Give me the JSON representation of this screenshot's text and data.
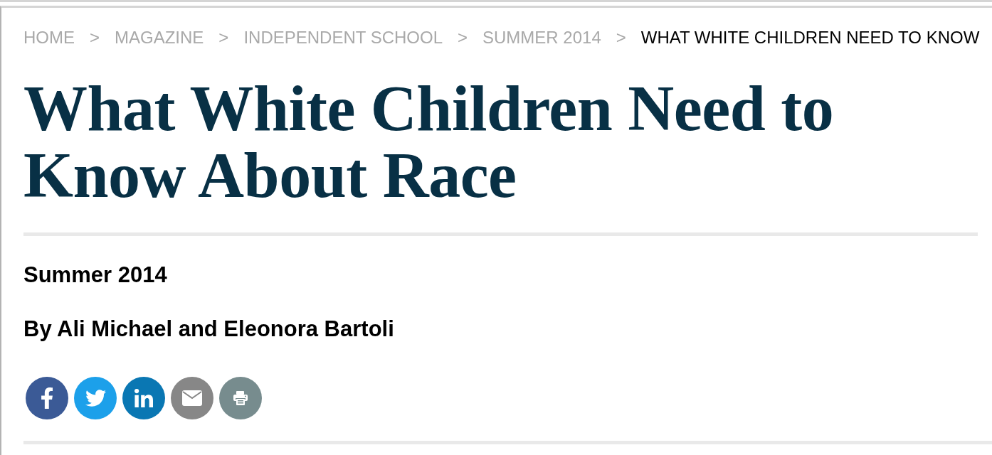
{
  "breadcrumb": [
    {
      "label": "HOME",
      "current": false,
      "separator": ">"
    },
    {
      "label": "MAGAZINE",
      "current": false,
      "separator": ">"
    },
    {
      "label": "INDEPENDENT SCHOOL",
      "current": false,
      "separator": ">"
    },
    {
      "label": "SUMMER 2014",
      "current": false,
      "separator": ">"
    },
    {
      "label": "WHAT WHITE CHILDREN NEED TO KNOW",
      "current": true
    }
  ],
  "article": {
    "title": "What White Children Need to Know About Race",
    "issue": "Summer 2014",
    "byline": "By Ali Michael and Eleonora Bartoli"
  },
  "share_buttons": [
    {
      "kind": "facebook",
      "color": "#3b5a96"
    },
    {
      "kind": "twitter",
      "color": "#1ca0ea"
    },
    {
      "kind": "linkedin",
      "color": "#0a77b3"
    },
    {
      "kind": "email",
      "color": "#878787"
    },
    {
      "kind": "print",
      "color": "#778c8e"
    }
  ]
}
